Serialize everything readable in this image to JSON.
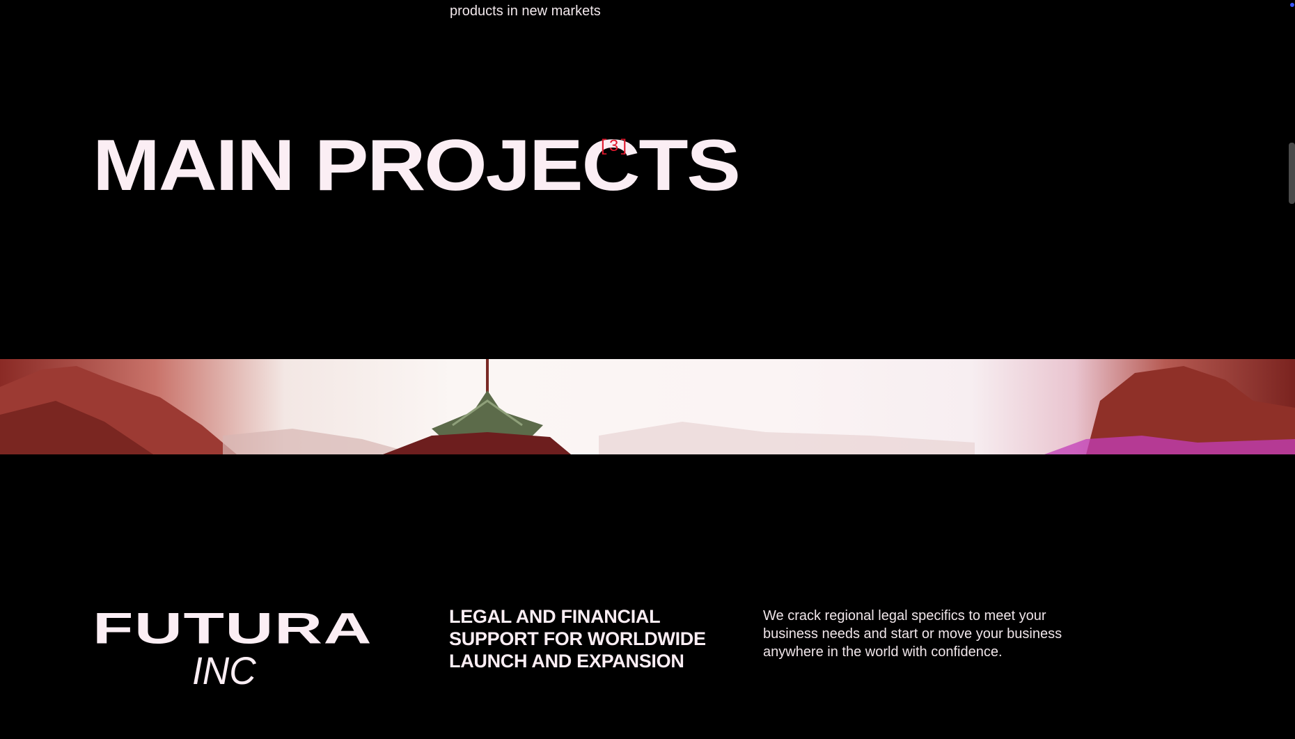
{
  "top_fragment": "products in new markets",
  "section": {
    "title": "MAIN PROJECTS",
    "count": "[3]"
  },
  "project": {
    "logo_main": "FUTURA",
    "logo_sub": "INC",
    "headline_lines": [
      "LEGAL AND FINANCIAL",
      "SUPPORT FOR WORLDWIDE",
      "LAUNCH AND EXPANSION"
    ],
    "description": "We crack regional legal specifics to meet your business needs and start or move your business anywhere in the world with confidence."
  },
  "colors": {
    "background": "#000000",
    "text": "#fbeef4",
    "accent": "#e0182d"
  }
}
